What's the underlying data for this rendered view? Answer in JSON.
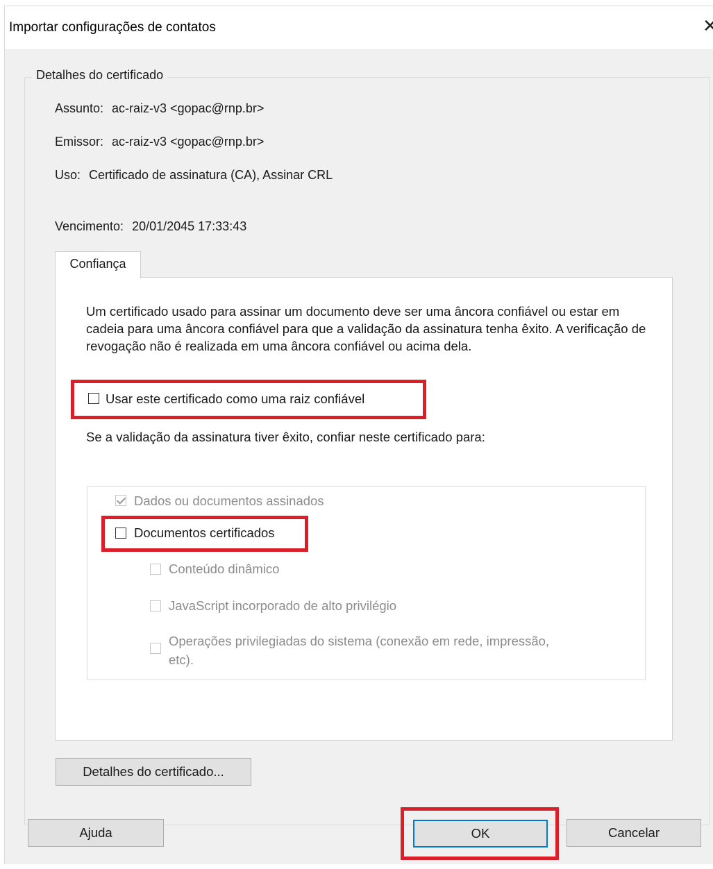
{
  "window": {
    "title": "Importar configurações de contatos",
    "close_glyph": "✕"
  },
  "certificate_details": {
    "group_label": "Detalhes do certificado",
    "subject_label": "Assunto:",
    "subject_value": "ac-raiz-v3 <gopac@rnp.br>",
    "issuer_label": "Emissor:",
    "issuer_value": "ac-raiz-v3 <gopac@rnp.br>",
    "usage_label": "Uso:",
    "usage_value": "Certificado de assinatura (CA), Assinar CRL",
    "expiry_label": "Vencimento:",
    "expiry_value": "20/01/2045 17:33:43"
  },
  "trust_tab": {
    "tab_label": "Confiança",
    "description": "Um certificado usado para assinar um documento deve ser uma âncora confiável ou estar em cadeia para uma âncora confiável para que a validação da assinatura tenha êxito. A verificação de revogação não é realizada em uma âncora confiável ou acima dela.",
    "root_checkbox": {
      "label": "Usar este certificado como uma raiz confiável",
      "checked": false
    },
    "trust_intro": "Se a validação da assinatura tiver êxito, confiar neste certificado para:",
    "options": {
      "signed_data": {
        "label": "Dados ou documentos assinados",
        "checked": true,
        "disabled": true
      },
      "certified_docs": {
        "label": "Documentos certificados",
        "checked": false,
        "disabled": false
      },
      "dynamic_content": {
        "label": "Conteúdo dinâmico",
        "checked": false,
        "disabled": true
      },
      "js_privileged": {
        "label": "JavaScript incorporado de alto privilégio",
        "checked": false,
        "disabled": true
      },
      "system_ops": {
        "label_line1": "Operações privilegiadas do sistema (conexão em rede, impressão,",
        "label_line2": "etc).",
        "checked": false,
        "disabled": true
      }
    }
  },
  "buttons": {
    "details": "Detalhes do certificado...",
    "help": "Ajuda",
    "ok": "OK",
    "cancel": "Cancelar"
  },
  "colors": {
    "highlight": "#d9202a",
    "default_button_border": "#0078d7",
    "dialog_bg": "#f0f0f0"
  },
  "icons": {
    "close": "close-icon",
    "check": "checkmark-icon"
  }
}
